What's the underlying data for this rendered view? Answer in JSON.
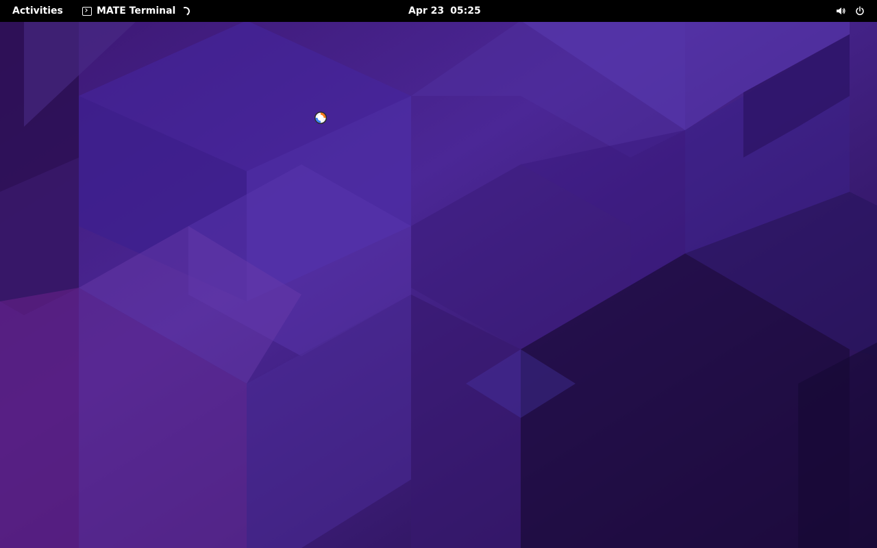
{
  "top_bar": {
    "activities_label": "Activities",
    "app_menu": {
      "label": "MATE Terminal",
      "icon": "terminal-icon",
      "busy_indicator": "loading-spinner-icon"
    },
    "clock": {
      "date": "Apr 23",
      "time": "05:25"
    },
    "system_tray": {
      "icons": [
        "volume-icon",
        "power-icon"
      ]
    }
  },
  "cursor": {
    "state": "busy",
    "icon": "busy-cursor-icon"
  },
  "colors": {
    "top_bar_bg": "#000000",
    "top_bar_text": "#ffffff",
    "wallpaper_primary": "#4a2590",
    "wallpaper_dark": "#1e0d3d"
  }
}
